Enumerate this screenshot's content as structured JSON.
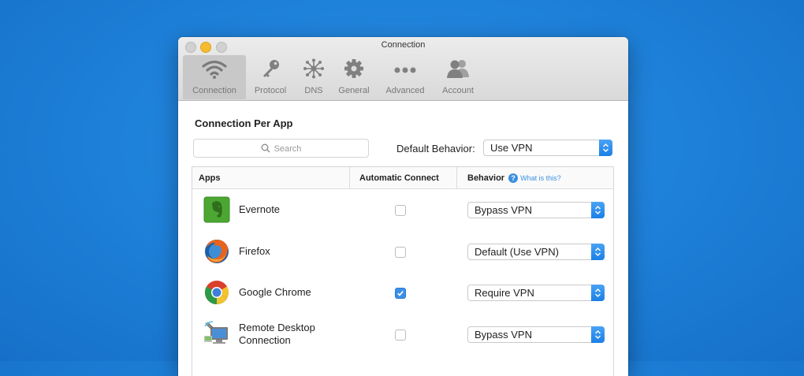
{
  "window": {
    "title": "Connection",
    "toolbar": [
      {
        "label": "Connection",
        "icon": "wifi-icon",
        "active": true
      },
      {
        "label": "Protocol",
        "icon": "key-icon",
        "active": false
      },
      {
        "label": "DNS",
        "icon": "network-icon",
        "active": false
      },
      {
        "label": "General",
        "icon": "gear-icon",
        "active": false
      },
      {
        "label": "Advanced",
        "icon": "more-dots-icon",
        "active": false
      },
      {
        "label": "Account",
        "icon": "users-icon",
        "active": false
      }
    ]
  },
  "panel": {
    "heading": "Connection Per App",
    "search_placeholder": "Search",
    "default_behavior_label": "Default Behavior:",
    "default_behavior_value": "Use VPN"
  },
  "table": {
    "headers": {
      "apps": "Apps",
      "auto_connect": "Automatic Connect",
      "behavior": "Behavior",
      "help": "?",
      "what_is_this": "What is this?"
    },
    "rows": [
      {
        "name": "Evernote",
        "icon": "evernote-icon",
        "auto_connect": false,
        "behavior": "Bypass VPN"
      },
      {
        "name": "Firefox",
        "icon": "firefox-icon",
        "auto_connect": false,
        "behavior": "Default (Use VPN)"
      },
      {
        "name": "Google Chrome",
        "icon": "chrome-icon",
        "auto_connect": true,
        "behavior": "Require VPN"
      },
      {
        "name": "Remote Desktop Connection",
        "icon": "remote-desktop-icon",
        "auto_connect": false,
        "behavior": "Bypass VPN"
      }
    ]
  },
  "colors": {
    "background": "#1d7fd8",
    "accent": "#3b8fe8",
    "minimize": "#f5bd2e"
  }
}
